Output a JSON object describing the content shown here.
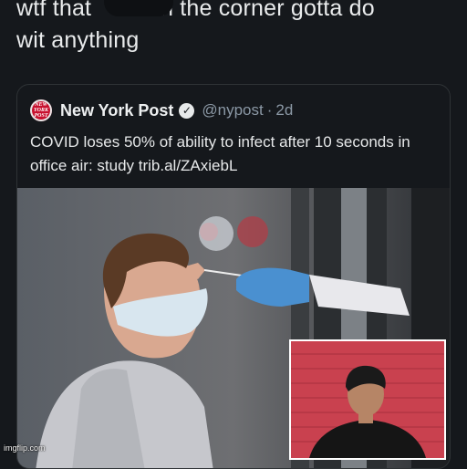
{
  "meme": {
    "caption_line1_start": "wtf that",
    "caption_line1_end": "in the corner gotta do",
    "caption_line2": "wit anything"
  },
  "tweet": {
    "avatar_text": "NEW YORK POST",
    "author_name": "New York Post",
    "handle": "@nypost",
    "separator": "·",
    "time": "2d",
    "text": "COVID loses 50% of ability to infect after 10 seconds in office air: study trib.al/ZAxiebL",
    "verified_icon": "verified-badge-icon"
  },
  "watermark": "imgflip.com",
  "colors": {
    "background": "#15181c",
    "text": "#e7e9ea",
    "secondary_text": "#8b98a5",
    "card_border": "#2f3336",
    "brand_red": "#c8102e"
  }
}
